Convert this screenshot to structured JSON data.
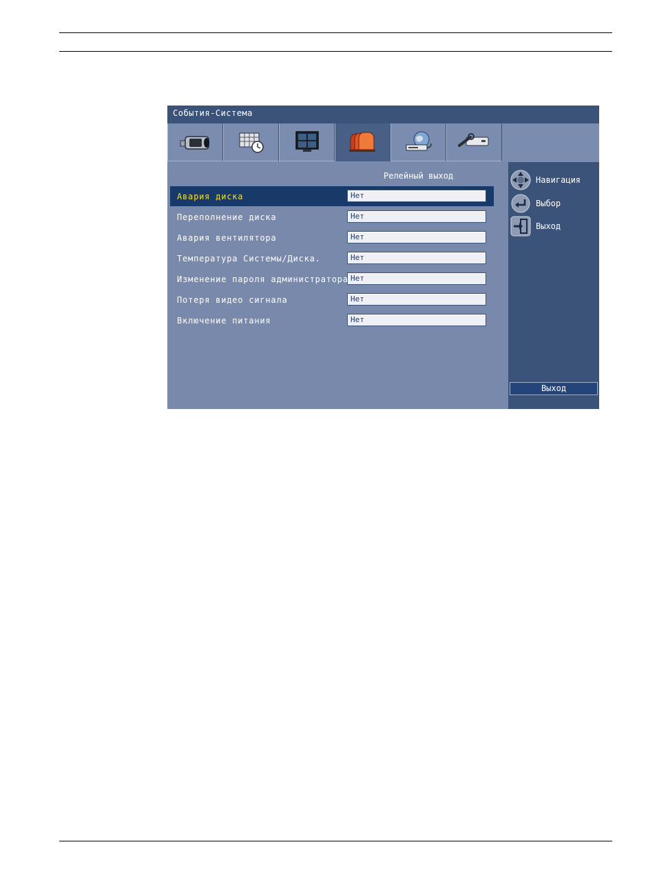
{
  "window": {
    "title": "События-Система"
  },
  "tabs": [
    {
      "icon": "camera-icon"
    },
    {
      "icon": "calendar-clock-icon"
    },
    {
      "icon": "monitor-icon"
    },
    {
      "icon": "alarm-events-icon",
      "active": true
    },
    {
      "icon": "network-globe-icon"
    },
    {
      "icon": "system-tools-icon"
    }
  ],
  "content": {
    "column_header": "Релейный выход",
    "rows": [
      {
        "label": "Авария диска",
        "value": "Нет",
        "selected": true
      },
      {
        "label": "Переполнение диска",
        "value": "Нет"
      },
      {
        "label": "Авария вентилятора",
        "value": "Нет"
      },
      {
        "label": "Температура Системы/Диска.",
        "value": "Нет"
      },
      {
        "label": "Изменение пароля администратора",
        "value": "Нет"
      },
      {
        "label": "Потеря видео сигнала",
        "value": "Нет"
      },
      {
        "label": "Включение питания",
        "value": "Нет"
      }
    ]
  },
  "sidebar": {
    "items": [
      {
        "icon": "navigation-dpad-icon",
        "label": "Навигация"
      },
      {
        "icon": "enter-icon",
        "label": "Выбор"
      },
      {
        "icon": "exit-door-icon",
        "label": "Выход"
      }
    ],
    "exit_button": "Выход"
  },
  "colors": {
    "panel": "#7889ab",
    "title_bar": "#3b5279",
    "selected_row": "#173a6a",
    "selected_text": "#f2dd3c"
  }
}
